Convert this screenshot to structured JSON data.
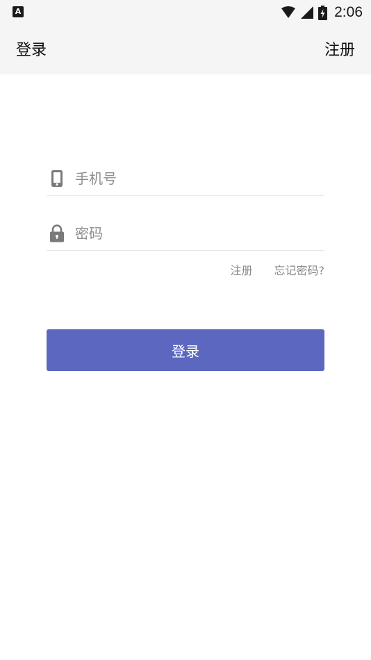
{
  "status_bar": {
    "app_icon_letter": "A",
    "time": "2:06",
    "icons": [
      "wifi-icon",
      "cell-signal-icon",
      "battery-charging-icon"
    ]
  },
  "app_bar": {
    "title": "登录",
    "action_label": "注册"
  },
  "form": {
    "phone": {
      "placeholder": "手机号",
      "value": "",
      "icon": "phone-icon"
    },
    "password": {
      "placeholder": "密码",
      "value": "",
      "icon": "lock-icon"
    },
    "register_link": "注册",
    "forgot_link": "忘记密码?",
    "submit_label": "登录"
  },
  "colors": {
    "primary": "#5c67bf",
    "bar_background": "#f5f5f5",
    "hint_text": "#8e8e8e",
    "divider": "#e8e8e8"
  }
}
